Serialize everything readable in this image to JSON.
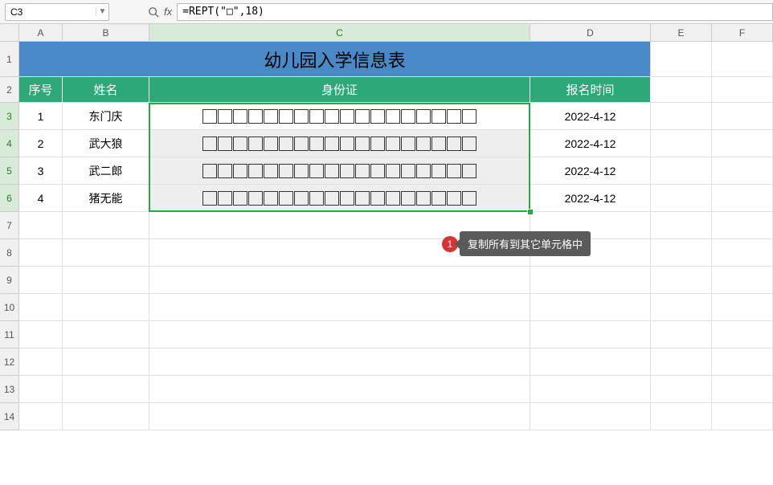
{
  "formula_bar": {
    "cell_ref": "C3",
    "fx": "fx",
    "formula": "=REPT(\"□\",18)"
  },
  "columns": [
    "A",
    "B",
    "C",
    "D",
    "E",
    "F"
  ],
  "rows": [
    "1",
    "2",
    "3",
    "4",
    "5",
    "6",
    "7",
    "8",
    "9",
    "10",
    "11",
    "12",
    "13",
    "14"
  ],
  "title": "幼儿园入学信息表",
  "headers": {
    "seq": "序号",
    "name": "姓名",
    "id": "身份证",
    "date": "报名时间"
  },
  "data": [
    {
      "seq": "1",
      "name": "东门庆",
      "date": "2022-4-12"
    },
    {
      "seq": "2",
      "name": "武大狼",
      "date": "2022-4-12"
    },
    {
      "seq": "3",
      "name": "武二郎",
      "date": "2022-4-12"
    },
    {
      "seq": "4",
      "name": "猪无能",
      "date": "2022-4-12"
    }
  ],
  "box_count": 18,
  "tooltip": {
    "num": "1",
    "text": "复制所有到其它单元格中"
  }
}
